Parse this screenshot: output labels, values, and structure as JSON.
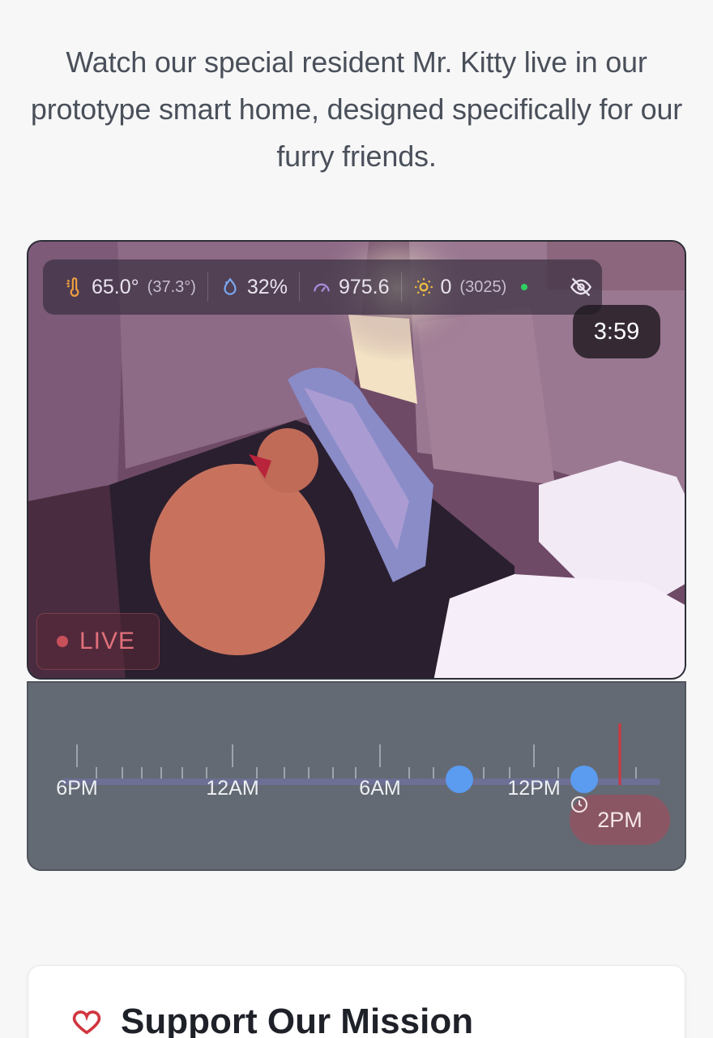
{
  "intro": {
    "text": "Watch our special resident Mr. Kitty live in our prototype smart home, designed specifically for our furry friends."
  },
  "camera": {
    "stats": {
      "temperature": "65.0°",
      "temperature_sub": "(37.3°)",
      "humidity": "32%",
      "pressure": "975.6",
      "light": "0",
      "light_sub": "(3025)"
    },
    "timer": "3:59",
    "live_label": "LIVE"
  },
  "timeline": {
    "labels": [
      "6PM",
      "12AM",
      "6AM",
      "12PM"
    ],
    "now_label": "2PM"
  },
  "support": {
    "title": "Support Our Mission"
  },
  "colors": {
    "live_red": "#c8505a",
    "clip_blue": "#5b9bf0",
    "status_green": "#2fd061",
    "playhead_red": "#d0363f"
  },
  "icons": [
    "thermometer-icon",
    "humidity-icon",
    "pressure-gauge-icon",
    "sun-icon",
    "eye-off-icon",
    "clock-icon",
    "heart-icon"
  ]
}
